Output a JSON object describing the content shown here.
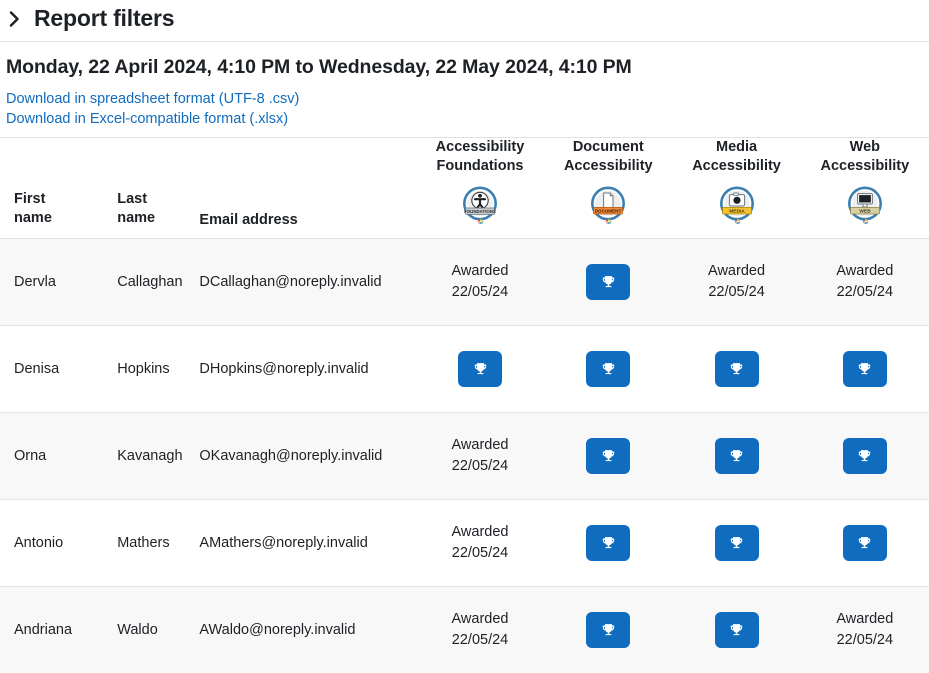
{
  "filters": {
    "toggle_icon": "chevron-right-icon",
    "title": "Report filters"
  },
  "range": {
    "title": "Monday, 22 April 2024, 4:10 PM to Wednesday, 22 May 2024, 4:10 PM"
  },
  "downloads": [
    {
      "label": "Download in spreadsheet format (UTF-8 .csv)"
    },
    {
      "label": "Download in Excel-compatible format (.xlsx)"
    }
  ],
  "table": {
    "headers": {
      "first_name": "First\nname",
      "first_name_line1": "First",
      "first_name_line2": "name",
      "last_name_line1": "Last",
      "last_name_line2": "name",
      "email": "Email address"
    },
    "badge_columns": [
      {
        "line1": "Accessibility",
        "line2": "Foundations",
        "icon": "badge-foundations-icon",
        "ribbon_text": "FOUNDATIONS",
        "ribbon_color": "#c8cdd2",
        "ring_color": "#3b7fb0",
        "glyph": "accessibility-person"
      },
      {
        "line1": "Document",
        "line2": "Accessibility",
        "icon": "badge-document-icon",
        "ribbon_text": "DOCUMENT",
        "ribbon_color": "#f08a3c",
        "ring_color": "#3b7fb0",
        "glyph": "document-page"
      },
      {
        "line1": "Media",
        "line2": "Accessibility",
        "icon": "badge-media-icon",
        "ribbon_text": "MEDIA",
        "ribbon_color": "#f2c230",
        "ring_color": "#3b7fb0",
        "glyph": "camera"
      },
      {
        "line1": "Web",
        "line2": "Accessibility",
        "icon": "badge-web-icon",
        "ribbon_text": "WEB",
        "ribbon_color": "#d9cfa0",
        "ring_color": "#3b7fb0",
        "glyph": "monitor"
      }
    ],
    "awarded_label": "Awarded",
    "trophy_icon": "trophy-icon",
    "rows": [
      {
        "first_name": "Dervla",
        "last_name": "Callaghan",
        "email": "DCallaghan@noreply.invalid",
        "badges": [
          {
            "state": "awarded",
            "label": "Awarded",
            "date": "22/05/24"
          },
          {
            "state": "button"
          },
          {
            "state": "awarded",
            "label": "Awarded",
            "date": "22/05/24"
          },
          {
            "state": "awarded",
            "label": "Awarded",
            "date": "22/05/24"
          }
        ]
      },
      {
        "first_name": "Denisa",
        "last_name": "Hopkins",
        "email": "DHopkins@noreply.invalid",
        "badges": [
          {
            "state": "button"
          },
          {
            "state": "button"
          },
          {
            "state": "button"
          },
          {
            "state": "button"
          }
        ]
      },
      {
        "first_name": "Orna",
        "last_name": "Kavanagh",
        "email": "OKavanagh@noreply.invalid",
        "badges": [
          {
            "state": "awarded",
            "label": "Awarded",
            "date": "22/05/24"
          },
          {
            "state": "button"
          },
          {
            "state": "button"
          },
          {
            "state": "button"
          }
        ]
      },
      {
        "first_name": "Antonio",
        "last_name": "Mathers",
        "email": "AMathers@noreply.invalid",
        "badges": [
          {
            "state": "awarded",
            "label": "Awarded",
            "date": "22/05/24"
          },
          {
            "state": "button"
          },
          {
            "state": "button"
          },
          {
            "state": "button"
          }
        ]
      },
      {
        "first_name": "Andriana",
        "last_name": "Waldo",
        "email": "AWaldo@noreply.invalid",
        "badges": [
          {
            "state": "awarded",
            "label": "Awarded",
            "date": "22/05/24"
          },
          {
            "state": "button"
          },
          {
            "state": "button"
          },
          {
            "state": "awarded",
            "label": "Awarded",
            "date": "22/05/24"
          }
        ]
      }
    ]
  },
  "colors": {
    "link": "#0f6cbf",
    "button": "#0f6cbf",
    "text": "#1d2125",
    "row_alt": "#f8f8f8",
    "border": "#dee2e6"
  }
}
